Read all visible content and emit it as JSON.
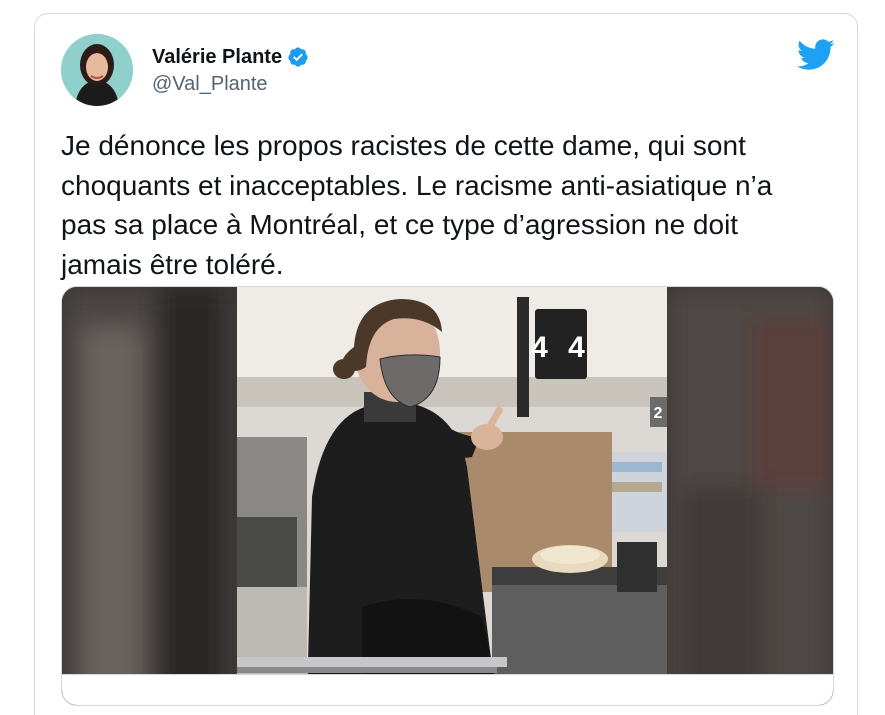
{
  "tweet": {
    "author": {
      "name": "Valérie Plante",
      "handle": "@Val_Plante",
      "verified": true
    },
    "text": "Je dénonce les propos racistes de cette dame, qui sont choquants et inacceptables. Le racisme anti-asiatique n’a pas sa place à Montréal, et ce type d’agression ne doit jamais être toléré.",
    "media": {
      "checkout_sign": "4 4",
      "side_sign": "2"
    }
  },
  "icons": {
    "verified": "verified-badge-icon",
    "brand": "twitter-bird-icon"
  },
  "colors": {
    "verified_blue": "#1d9bf0",
    "twitter_blue": "#1da1f2",
    "text_primary": "#0f1419",
    "text_secondary": "#536471",
    "border": "#cfd9de"
  }
}
